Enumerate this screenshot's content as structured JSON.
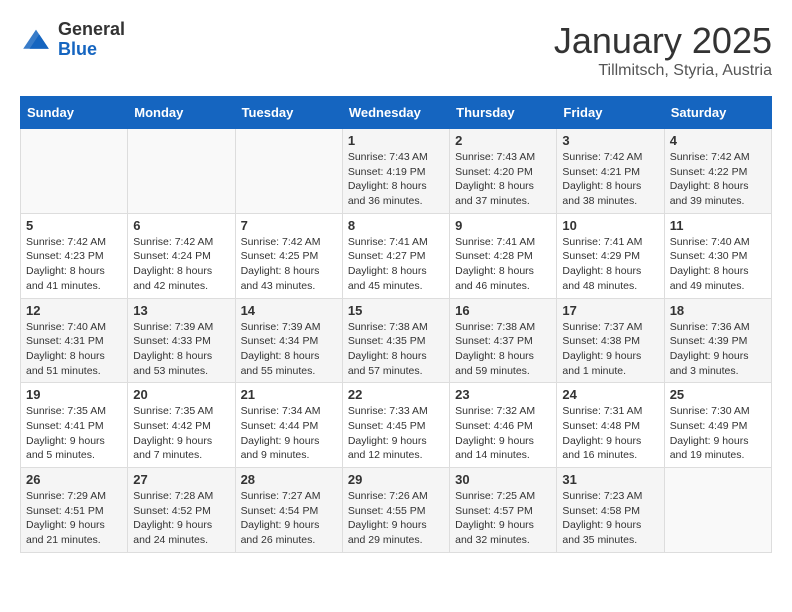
{
  "logo": {
    "general": "General",
    "blue": "Blue"
  },
  "title": "January 2025",
  "subtitle": "Tillmitsch, Styria, Austria",
  "days_of_week": [
    "Sunday",
    "Monday",
    "Tuesday",
    "Wednesday",
    "Thursday",
    "Friday",
    "Saturday"
  ],
  "weeks": [
    [
      {
        "day": "",
        "sunrise": "",
        "sunset": "",
        "daylight": ""
      },
      {
        "day": "",
        "sunrise": "",
        "sunset": "",
        "daylight": ""
      },
      {
        "day": "",
        "sunrise": "",
        "sunset": "",
        "daylight": ""
      },
      {
        "day": "1",
        "sunrise": "Sunrise: 7:43 AM",
        "sunset": "Sunset: 4:19 PM",
        "daylight": "Daylight: 8 hours and 36 minutes."
      },
      {
        "day": "2",
        "sunrise": "Sunrise: 7:43 AM",
        "sunset": "Sunset: 4:20 PM",
        "daylight": "Daylight: 8 hours and 37 minutes."
      },
      {
        "day": "3",
        "sunrise": "Sunrise: 7:42 AM",
        "sunset": "Sunset: 4:21 PM",
        "daylight": "Daylight: 8 hours and 38 minutes."
      },
      {
        "day": "4",
        "sunrise": "Sunrise: 7:42 AM",
        "sunset": "Sunset: 4:22 PM",
        "daylight": "Daylight: 8 hours and 39 minutes."
      }
    ],
    [
      {
        "day": "5",
        "sunrise": "Sunrise: 7:42 AM",
        "sunset": "Sunset: 4:23 PM",
        "daylight": "Daylight: 8 hours and 41 minutes."
      },
      {
        "day": "6",
        "sunrise": "Sunrise: 7:42 AM",
        "sunset": "Sunset: 4:24 PM",
        "daylight": "Daylight: 8 hours and 42 minutes."
      },
      {
        "day": "7",
        "sunrise": "Sunrise: 7:42 AM",
        "sunset": "Sunset: 4:25 PM",
        "daylight": "Daylight: 8 hours and 43 minutes."
      },
      {
        "day": "8",
        "sunrise": "Sunrise: 7:41 AM",
        "sunset": "Sunset: 4:27 PM",
        "daylight": "Daylight: 8 hours and 45 minutes."
      },
      {
        "day": "9",
        "sunrise": "Sunrise: 7:41 AM",
        "sunset": "Sunset: 4:28 PM",
        "daylight": "Daylight: 8 hours and 46 minutes."
      },
      {
        "day": "10",
        "sunrise": "Sunrise: 7:41 AM",
        "sunset": "Sunset: 4:29 PM",
        "daylight": "Daylight: 8 hours and 48 minutes."
      },
      {
        "day": "11",
        "sunrise": "Sunrise: 7:40 AM",
        "sunset": "Sunset: 4:30 PM",
        "daylight": "Daylight: 8 hours and 49 minutes."
      }
    ],
    [
      {
        "day": "12",
        "sunrise": "Sunrise: 7:40 AM",
        "sunset": "Sunset: 4:31 PM",
        "daylight": "Daylight: 8 hours and 51 minutes."
      },
      {
        "day": "13",
        "sunrise": "Sunrise: 7:39 AM",
        "sunset": "Sunset: 4:33 PM",
        "daylight": "Daylight: 8 hours and 53 minutes."
      },
      {
        "day": "14",
        "sunrise": "Sunrise: 7:39 AM",
        "sunset": "Sunset: 4:34 PM",
        "daylight": "Daylight: 8 hours and 55 minutes."
      },
      {
        "day": "15",
        "sunrise": "Sunrise: 7:38 AM",
        "sunset": "Sunset: 4:35 PM",
        "daylight": "Daylight: 8 hours and 57 minutes."
      },
      {
        "day": "16",
        "sunrise": "Sunrise: 7:38 AM",
        "sunset": "Sunset: 4:37 PM",
        "daylight": "Daylight: 8 hours and 59 minutes."
      },
      {
        "day": "17",
        "sunrise": "Sunrise: 7:37 AM",
        "sunset": "Sunset: 4:38 PM",
        "daylight": "Daylight: 9 hours and 1 minute."
      },
      {
        "day": "18",
        "sunrise": "Sunrise: 7:36 AM",
        "sunset": "Sunset: 4:39 PM",
        "daylight": "Daylight: 9 hours and 3 minutes."
      }
    ],
    [
      {
        "day": "19",
        "sunrise": "Sunrise: 7:35 AM",
        "sunset": "Sunset: 4:41 PM",
        "daylight": "Daylight: 9 hours and 5 minutes."
      },
      {
        "day": "20",
        "sunrise": "Sunrise: 7:35 AM",
        "sunset": "Sunset: 4:42 PM",
        "daylight": "Daylight: 9 hours and 7 minutes."
      },
      {
        "day": "21",
        "sunrise": "Sunrise: 7:34 AM",
        "sunset": "Sunset: 4:44 PM",
        "daylight": "Daylight: 9 hours and 9 minutes."
      },
      {
        "day": "22",
        "sunrise": "Sunrise: 7:33 AM",
        "sunset": "Sunset: 4:45 PM",
        "daylight": "Daylight: 9 hours and 12 minutes."
      },
      {
        "day": "23",
        "sunrise": "Sunrise: 7:32 AM",
        "sunset": "Sunset: 4:46 PM",
        "daylight": "Daylight: 9 hours and 14 minutes."
      },
      {
        "day": "24",
        "sunrise": "Sunrise: 7:31 AM",
        "sunset": "Sunset: 4:48 PM",
        "daylight": "Daylight: 9 hours and 16 minutes."
      },
      {
        "day": "25",
        "sunrise": "Sunrise: 7:30 AM",
        "sunset": "Sunset: 4:49 PM",
        "daylight": "Daylight: 9 hours and 19 minutes."
      }
    ],
    [
      {
        "day": "26",
        "sunrise": "Sunrise: 7:29 AM",
        "sunset": "Sunset: 4:51 PM",
        "daylight": "Daylight: 9 hours and 21 minutes."
      },
      {
        "day": "27",
        "sunrise": "Sunrise: 7:28 AM",
        "sunset": "Sunset: 4:52 PM",
        "daylight": "Daylight: 9 hours and 24 minutes."
      },
      {
        "day": "28",
        "sunrise": "Sunrise: 7:27 AM",
        "sunset": "Sunset: 4:54 PM",
        "daylight": "Daylight: 9 hours and 26 minutes."
      },
      {
        "day": "29",
        "sunrise": "Sunrise: 7:26 AM",
        "sunset": "Sunset: 4:55 PM",
        "daylight": "Daylight: 9 hours and 29 minutes."
      },
      {
        "day": "30",
        "sunrise": "Sunrise: 7:25 AM",
        "sunset": "Sunset: 4:57 PM",
        "daylight": "Daylight: 9 hours and 32 minutes."
      },
      {
        "day": "31",
        "sunrise": "Sunrise: 7:23 AM",
        "sunset": "Sunset: 4:58 PM",
        "daylight": "Daylight: 9 hours and 35 minutes."
      },
      {
        "day": "",
        "sunrise": "",
        "sunset": "",
        "daylight": ""
      }
    ]
  ]
}
